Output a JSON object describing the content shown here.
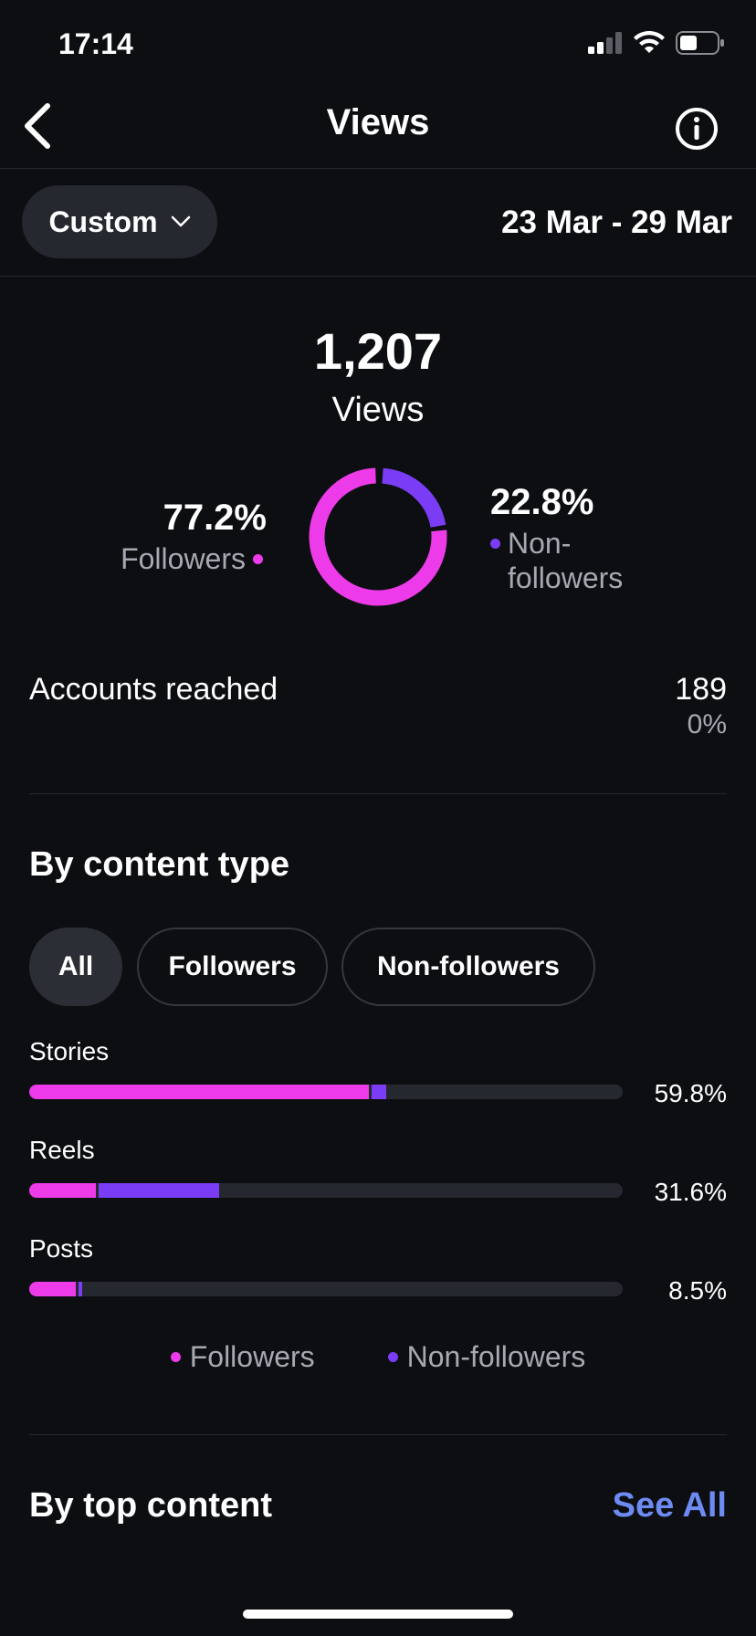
{
  "status_bar": {
    "time": "17:14"
  },
  "header": {
    "title": "Views"
  },
  "filter": {
    "range_label": "Custom",
    "date_range": "23 Mar - 29 Mar"
  },
  "summary": {
    "total": "1,207",
    "total_label": "Views",
    "followers_pct": "77.2%",
    "followers_label": "Followers",
    "nonfollowers_pct": "22.8%",
    "nonfollowers_label_line1": "Non-",
    "nonfollowers_label_line2": "followers",
    "followers_fraction": 0.772,
    "nonfollowers_fraction": 0.228
  },
  "accounts_reached": {
    "label": "Accounts reached",
    "value": "189",
    "change": "0%"
  },
  "content_type": {
    "title": "By content type",
    "chips": [
      "All",
      "Followers",
      "Non-followers"
    ],
    "active_chip": "All",
    "rows": [
      {
        "label": "Stories",
        "pct": "59.8%",
        "followers_fraction": 0.573,
        "nonfollowers_fraction": 0.025
      },
      {
        "label": "Reels",
        "pct": "31.6%",
        "followers_fraction": 0.113,
        "nonfollowers_fraction": 0.203
      },
      {
        "label": "Posts",
        "pct": "8.5%",
        "followers_fraction": 0.079,
        "nonfollowers_fraction": 0.006
      }
    ],
    "legend": [
      "Followers",
      "Non-followers"
    ]
  },
  "top_content": {
    "title": "By top content",
    "see_all": "See All"
  },
  "colors": {
    "followers": "#ee3be9",
    "nonfollowers": "#7a3df5",
    "link": "#6d8bf3",
    "background": "#0c0e12"
  }
}
